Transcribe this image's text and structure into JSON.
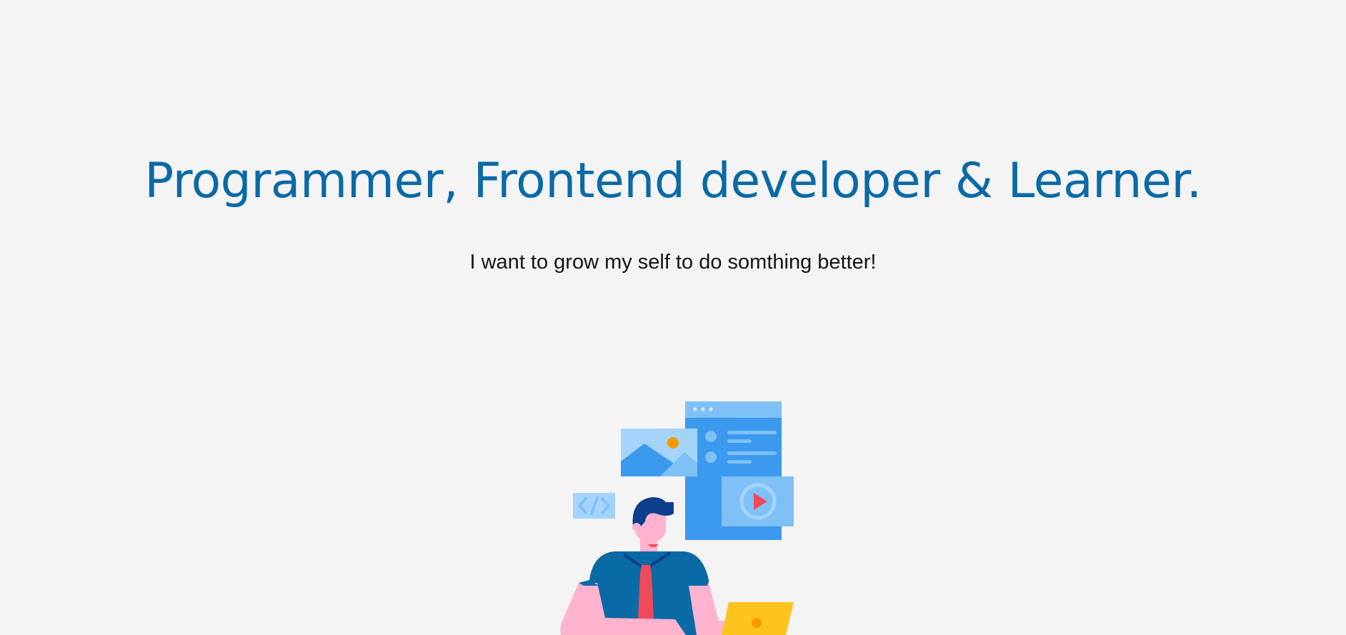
{
  "hero": {
    "headline": "Programmer, Frontend developer & Learner.",
    "subtitle": "I want to grow my self to do somthing better!"
  },
  "illustration": {
    "name": "developer-at-laptop-illustration",
    "colors": {
      "primary_blue": "#3b9aee",
      "light_blue": "#7fc0f7",
      "pale_blue": "#a5d4fa",
      "navy": "#0d3f8c",
      "shirt": "#0a6aa6",
      "skin": "#ffb3cf",
      "tie": "#ef4a5a",
      "laptop": "#ffc31f",
      "accent_orange": "#f59a00"
    }
  }
}
